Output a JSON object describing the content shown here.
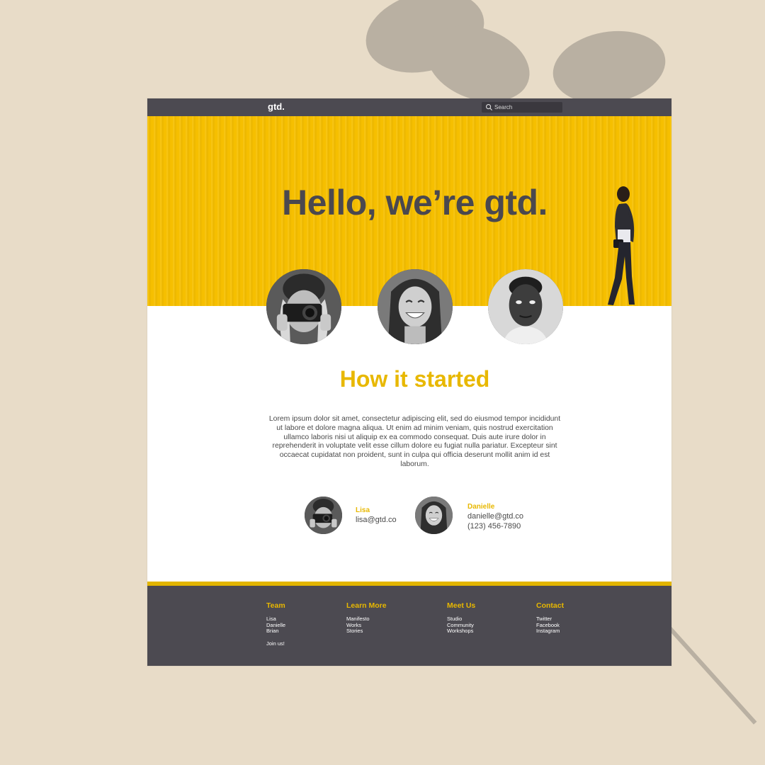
{
  "nav": {
    "logo": "gtd.",
    "search_placeholder": "Search",
    "search_icon": "search-icon"
  },
  "hero": {
    "title": "Hello, we’re gtd."
  },
  "team_photos": [
    {
      "subject": "person with camera"
    },
    {
      "subject": "smiling woman"
    },
    {
      "subject": "man portrait"
    }
  ],
  "section": {
    "title": "How it started",
    "body": "Lorem ipsum dolor sit amet, consectetur adipiscing elit, sed do eiusmod tempor incididunt ut labore et dolore magna aliqua. Ut enim ad minim veniam, quis nostrud exercitation ullamco laboris nisi ut aliquip ex ea commodo consequat. Duis aute irure dolor in reprehenderit in voluptate velit esse cillum dolore eu fugiat nulla pariatur. Excepteur sint occaecat cupidatat non proident, sunt in culpa qui officia deserunt mollit anim id est laborum."
  },
  "contacts": [
    {
      "name": "Lisa",
      "email": "lisa@gtd.co"
    },
    {
      "name": "Danielle",
      "email": "danielle@gtd.co",
      "phone": "(123) 456-7890"
    }
  ],
  "footer": {
    "columns": [
      {
        "heading": "Team",
        "links": [
          "Lisa",
          "Danielle",
          "Brian"
        ],
        "extra": "Join us!"
      },
      {
        "heading": "Learn More",
        "links": [
          "Manifesto",
          "Works",
          "Stories"
        ]
      },
      {
        "heading": "Meet Us",
        "links": [
          "Studio",
          "Community",
          "Workshops"
        ]
      },
      {
        "heading": "Contact",
        "links": [
          "Twitter",
          "Facebook",
          "Instagram"
        ]
      }
    ]
  },
  "colors": {
    "background": "#e8dcc8",
    "nav": "#4c4a51",
    "accent_yellow": "#f6bf00",
    "heading_yellow": "#e8b800",
    "text_dark": "#4a484f"
  }
}
